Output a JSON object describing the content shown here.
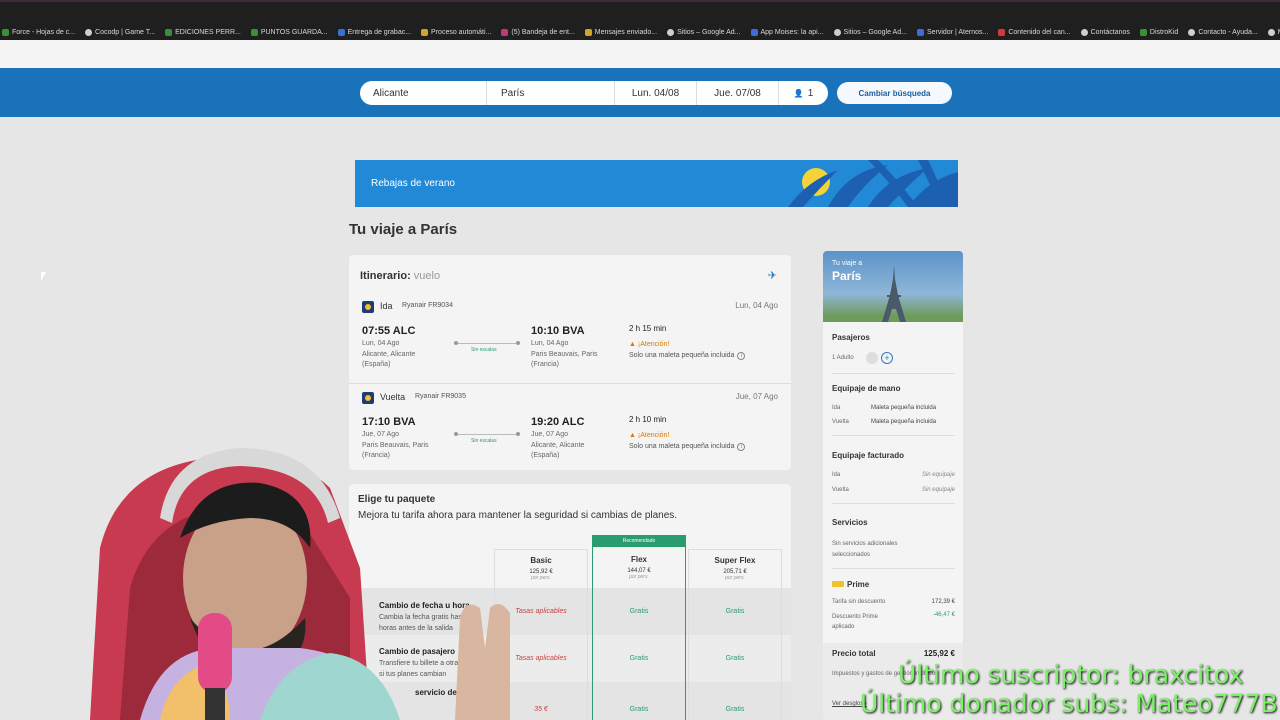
{
  "bookmarks": [
    {
      "label": "Force - Hojas de c...",
      "color": "g"
    },
    {
      "label": "Cocodp | Game T...",
      "color": "w"
    },
    {
      "label": "EDICIONES PERR...",
      "color": "g"
    },
    {
      "label": "PUNTOS GUARDA...",
      "color": "g"
    },
    {
      "label": "Entrega de grabac...",
      "color": "b"
    },
    {
      "label": "Proceso automáti...",
      "color": "y"
    },
    {
      "label": "(5) Bandeja de ent...",
      "color": "p"
    },
    {
      "label": "Mensajes enviado...",
      "color": "y"
    },
    {
      "label": "Sitios – Google Ad...",
      "color": "w"
    },
    {
      "label": "App Moises: la api...",
      "color": "b"
    },
    {
      "label": "Sitios – Google Ad...",
      "color": "w"
    },
    {
      "label": "Servidor | Aternos...",
      "color": "b"
    },
    {
      "label": "Contenido del can...",
      "color": "r"
    },
    {
      "label": "Contáctanos",
      "color": "w"
    },
    {
      "label": "DistroKid",
      "color": "g"
    },
    {
      "label": "Contacto - Ayuda...",
      "color": "w"
    },
    {
      "label": "Mobile I",
      "color": "w"
    }
  ],
  "search": {
    "origin": "Alicante",
    "destination": "París",
    "depart": "Lun. 04/08",
    "return": "Jue. 07/08",
    "passengers": "1",
    "change_label": "Cambiar búsqueda"
  },
  "banner": {
    "text": "Rebajas de verano"
  },
  "trip_title": "Tu viaje a París",
  "itinerary": {
    "title": "Itinerario:",
    "title_muted": "vuelo",
    "legs": [
      {
        "label": "Ida",
        "flight": "Ryanair FR9034",
        "date": "Lun, 04 Ago",
        "dep_time": "07:55 ALC",
        "dep_date": "Lun, 04 Ago",
        "dep_place": "Alicante, Alicante (España)",
        "stops": "Sin escalas",
        "arr_time": "10:10 BVA",
        "arr_date": "Lun, 04 Ago",
        "arr_place": "Paris Beauvais, Paris (Francia)",
        "duration": "2 h 15 min",
        "attention": "¡Atención!",
        "bag": "Solo una maleta pequeña incluida"
      },
      {
        "label": "Vuelta",
        "flight": "Ryanair FR9035",
        "date": "Jue, 07 Ago",
        "dep_time": "17:10 BVA",
        "dep_date": "Jue, 07 Ago",
        "dep_place": "Paris Beauvais, Paris (Francia)",
        "stops": "Sin escalas",
        "arr_time": "19:20 ALC",
        "arr_date": "Jue, 07 Ago",
        "arr_place": "Alicante, Alicante (España)",
        "duration": "2 h 10 min",
        "attention": "¡Atención!",
        "bag": "Solo una maleta pequeña incluida"
      }
    ]
  },
  "package": {
    "title": "Elige tu paquete",
    "subtitle": "Mejora tu tarifa ahora para mantener la seguridad si cambias de planes.",
    "recommended": "Recomendado",
    "columns": [
      {
        "name": "Basic",
        "price": "125,92 €",
        "per": "por pers."
      },
      {
        "name": "Flex",
        "price": "144,07 €",
        "per": "por pers."
      },
      {
        "name": "Super Flex",
        "price": "205,71 €",
        "per": "por pers."
      }
    ],
    "rows": [
      {
        "title": "Cambio de fecha u hora",
        "desc": "Cambia la fecha gratis hasta 24 horas antes de la salida",
        "cells": [
          "Tasas aplicables",
          "Gratis",
          "Gratis"
        ]
      },
      {
        "title": "Cambio de pasajero",
        "desc": "Transfiere tu billete a otra persona si tus planes cambian",
        "cells": [
          "Tasas aplicables",
          "Gratis",
          "Gratis"
        ]
      },
      {
        "title": "servicio des",
        "desc": "",
        "cells": [
          "35 €",
          "Gratis",
          "Gratis"
        ]
      }
    ]
  },
  "summary": {
    "hero_sub": "Tu viaje a",
    "hero_title": "París",
    "passengers_h": "Pasajeros",
    "passengers_v": "1 Adulto",
    "hand_h": "Equipaje de mano",
    "hand_ida_l": "Ida",
    "hand_ida_v": "Maleta pequeña incluida",
    "hand_vuelta_l": "Vuelta",
    "hand_vuelta_v": "Maleta pequeña incluida",
    "checked_h": "Equipaje facturado",
    "checked_ida_l": "Ida",
    "checked_ida_v": "Sin equipaje",
    "checked_vuelta_l": "Vuelta",
    "checked_vuelta_v": "Sin equipaje",
    "services_h": "Servicios",
    "services_v": "Sin servicios adicionales seleccionados",
    "prime": "Prime",
    "no_discount_l": "Tarifa sin descuento",
    "no_discount_v": "172,39 €",
    "prime_discount_l": "Descuento Prime aplicado",
    "prime_discount_v": "-46,47 €",
    "total_l": "Precio total",
    "total_v": "125,92 €",
    "taxes": "Impuestos y gastos de gestión incluidos",
    "details": "Ver desglose"
  },
  "overlay": {
    "line1": "Último suscriptor: braxcitox",
    "line2": "Último donador subs: Mateo777B"
  },
  "colors": {
    "header": "#1a72bb",
    "banner": "#2289d6",
    "flex_green": "#2a9d6e",
    "overlay_green": "#7df06a"
  }
}
